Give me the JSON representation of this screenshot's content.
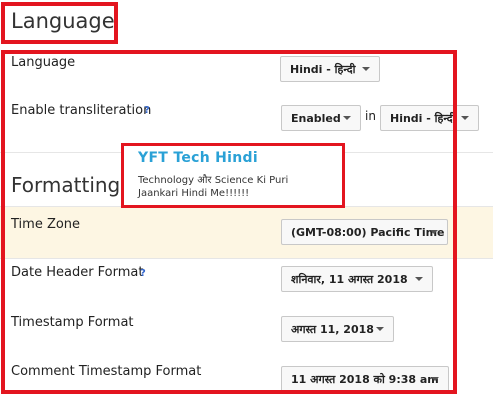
{
  "language_section": {
    "title": "Language",
    "language": {
      "label": "Language",
      "value": "Hindi - हिन्दी"
    },
    "transliteration": {
      "label": "Enable transliteration",
      "help": "?",
      "value": "Enabled",
      "in_label": "in",
      "language_value": "Hindi - हिन्दी"
    }
  },
  "watermark": {
    "title": "YFT Tech Hindi",
    "line1": "Technology और Science Ki Puri",
    "line2": "Jaankari Hindi Me!!!!!!"
  },
  "formatting_section": {
    "title": "Formatting",
    "time_zone": {
      "label": "Time Zone",
      "value": "(GMT-08:00) Pacific Time"
    },
    "date_header": {
      "label": "Date Header Format",
      "help": "?",
      "value": "शनिवार, 11 अगस्त 2018"
    },
    "timestamp": {
      "label": "Timestamp Format",
      "value": "अगस्त 11, 2018"
    },
    "comment_timestamp": {
      "label": "Comment Timestamp Format",
      "value": "11 अगस्त 2018 को 9:38 am"
    }
  },
  "colors": {
    "annotation_red": "#e3151f",
    "highlight_row": "#fdf6e3",
    "watermark_blue": "#2aa1d6"
  }
}
